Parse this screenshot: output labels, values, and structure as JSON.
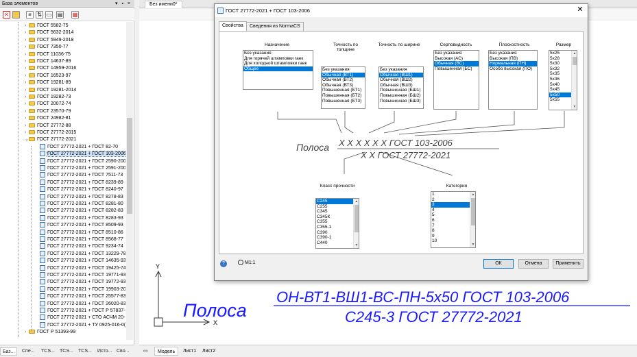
{
  "left_panel": {
    "title": "База элементов",
    "header_controls": "▾ ▪ ×",
    "toolbar_icons": [
      "delete-icon",
      "folder-open-icon",
      "properties-icon",
      "filter-icon",
      "copy-icon",
      "print-icon",
      "report-icon"
    ],
    "tree": [
      {
        "label": "ГОСТ 5582-75",
        "type": "folder"
      },
      {
        "label": "ГОСТ 5632-2014",
        "type": "folder"
      },
      {
        "label": "ГОСТ 5949-2018",
        "type": "folder"
      },
      {
        "label": "ГОСТ 7350-77",
        "type": "folder"
      },
      {
        "label": "ГОСТ 11036-75",
        "type": "folder"
      },
      {
        "label": "ГОСТ 14637-89",
        "type": "folder"
      },
      {
        "label": "ГОСТ 14959-2016",
        "type": "folder"
      },
      {
        "label": "ГОСТ 16523-97",
        "type": "folder"
      },
      {
        "label": "ГОСТ 19281-89",
        "type": "folder"
      },
      {
        "label": "ГОСТ 19281-2014",
        "type": "folder"
      },
      {
        "label": "ГОСТ 19282-73",
        "type": "folder"
      },
      {
        "label": "ГОСТ 20072-74",
        "type": "folder"
      },
      {
        "label": "ГОСТ 23570-79",
        "type": "folder"
      },
      {
        "label": "ГОСТ 24982-81",
        "type": "folder"
      },
      {
        "label": "ГОСТ 27772-88",
        "type": "folder"
      },
      {
        "label": "ГОСТ 27772-2015",
        "type": "folder"
      },
      {
        "label": "ГОСТ 27772-2021",
        "type": "folder-open"
      },
      {
        "label": "ГОСТ 27772-2021 + ГОСТ 82-70",
        "type": "doc"
      },
      {
        "label": "ГОСТ 27772-2021 + ГОСТ 103-2006",
        "type": "doc",
        "selected": true
      },
      {
        "label": "ГОСТ 27772-2021 + ГОСТ 2590-200",
        "type": "doc"
      },
      {
        "label": "ГОСТ 27772-2021 + ГОСТ 2591-200",
        "type": "doc"
      },
      {
        "label": "ГОСТ 27772-2021 + ГОСТ 7511-73",
        "type": "doc"
      },
      {
        "label": "ГОСТ 27772-2021 + ГОСТ 8239-89",
        "type": "doc"
      },
      {
        "label": "ГОСТ 27772-2021 + ГОСТ 8240-97",
        "type": "doc"
      },
      {
        "label": "ГОСТ 27772-2021 + ГОСТ 8278-83",
        "type": "doc"
      },
      {
        "label": "ГОСТ 27772-2021 + ГОСТ 8281-80",
        "type": "doc"
      },
      {
        "label": "ГОСТ 27772-2021 + ГОСТ 8282-83",
        "type": "doc"
      },
      {
        "label": "ГОСТ 27772-2021 + ГОСТ 8283-93",
        "type": "doc"
      },
      {
        "label": "ГОСТ 27772-2021 + ГОСТ 8509-93",
        "type": "doc"
      },
      {
        "label": "ГОСТ 27772-2021 + ГОСТ 8510-86",
        "type": "doc"
      },
      {
        "label": "ГОСТ 27772-2021 + ГОСТ 8568-77",
        "type": "doc"
      },
      {
        "label": "ГОСТ 27772-2021 + ГОСТ 9234-74",
        "type": "doc"
      },
      {
        "label": "ГОСТ 27772-2021 + ГОСТ 13229-78",
        "type": "doc"
      },
      {
        "label": "ГОСТ 27772-2021 + ГОСТ 14635-93",
        "type": "doc"
      },
      {
        "label": "ГОСТ 27772-2021 + ГОСТ 19425-74",
        "type": "doc"
      },
      {
        "label": "ГОСТ 27772-2021 + ГОСТ 19771-93",
        "type": "doc"
      },
      {
        "label": "ГОСТ 27772-2021 + ГОСТ 19772-93",
        "type": "doc"
      },
      {
        "label": "ГОСТ 27772-2021 + ГОСТ 19903-20",
        "type": "doc"
      },
      {
        "label": "ГОСТ 27772-2021 + ГОСТ 25577-83",
        "type": "doc"
      },
      {
        "label": "ГОСТ 27772-2021 + ГОСТ 26020-83",
        "type": "doc"
      },
      {
        "label": "ГОСТ 27772-2021 + ГОСТ Р 57837-",
        "type": "doc"
      },
      {
        "label": "ГОСТ 27772-2021 + СТО АСЧМ 20-",
        "type": "doc"
      },
      {
        "label": "ГОСТ 27772-2021 + ТУ 0925-016-0(",
        "type": "doc"
      },
      {
        "label": "ГОСТ Р 51393-99",
        "type": "folder"
      }
    ],
    "bottom_tabs": [
      "Баз...",
      "Спе...",
      "TCS...",
      "TCS...",
      "TCS...",
      "Исто...",
      "Сво..."
    ]
  },
  "document": {
    "tab_label": "Без имени0*",
    "sheet_tabs": [
      "Модель",
      "Лист1",
      "Лист2"
    ],
    "axis_y": "Y",
    "axis_x": "X",
    "drawing": {
      "prefix": "Полоса",
      "numerator": "ОН-ВТ1-ВШ1-ВС-ПН-5x50 ГОСТ 103-2006",
      "denominator": "С245-3 ГОСТ 27772-2021",
      "color": "#1a1aff"
    }
  },
  "dialog": {
    "title": "ГОСТ 27772-2021 + ГОСТ 103-2006",
    "tabs": [
      "Свойства",
      "Сведения из NormaCS"
    ],
    "columns": [
      {
        "header": "Назначение",
        "items": [
          "Без указания",
          "Для горячей штамповки гаек",
          "Для холодной штамповки гаек",
          "Общее"
        ],
        "selected": 3
      },
      {
        "header": "Точность по толщине",
        "items": [
          "Без указания",
          "Обычная (ВТ1)",
          "Обычная (ВТ2)",
          "Обычная (ВТ3)",
          "Повышенная (БТ1)",
          "Повышенная (БТ2)",
          "Повышенная (БТ3)"
        ],
        "selected": 1
      },
      {
        "header": "Точность по ширине",
        "items": [
          "Без указания",
          "Обычная (ВШ1)",
          "Обычная (ВШ2)",
          "Обычная (ВШ3)",
          "Повышенная (БШ1)",
          "Повышенная (БШ2)",
          "Повышенная (БШ3)"
        ],
        "selected": 1
      },
      {
        "header": "Серповидность",
        "items": [
          "Без указания",
          "Высокая (АС)",
          "Обычная (ВС)",
          "Повышенная (БС)"
        ],
        "selected": 2
      },
      {
        "header": "Плоскостность",
        "items": [
          "Без указания",
          "Высокая (ПВ)",
          "Нормальная (ПН)",
          "Особо высокая (ПО)"
        ],
        "selected": 2
      },
      {
        "header": "Размер",
        "items": [
          "5x25",
          "5x28",
          "5x30",
          "5x32",
          "5x35",
          "5x36",
          "5x40",
          "5x45",
          "5x50",
          "5x55"
        ],
        "selected": 8
      }
    ],
    "formula": {
      "prefix": "Полоса",
      "numerator": "X X X X X X ГОСТ 103-2006",
      "denominator": "X X ГОСТ 27772-2021"
    },
    "lower_columns": [
      {
        "header": "Класс прочности",
        "items": [
          "С245",
          "С255",
          "С345",
          "С345К",
          "С355",
          "С355-1",
          "С390",
          "С390-1",
          "С440"
        ],
        "selected": 0
      },
      {
        "header": "Категория",
        "items": [
          "1",
          "2",
          "3",
          "4",
          "5",
          "6",
          "7",
          "8",
          "9",
          "10"
        ],
        "selected": 2
      }
    ],
    "help_label": "?",
    "zoom_label": "M1:1",
    "buttons": {
      "ok": "ОК",
      "cancel": "Отмена",
      "apply": "Применить"
    }
  }
}
